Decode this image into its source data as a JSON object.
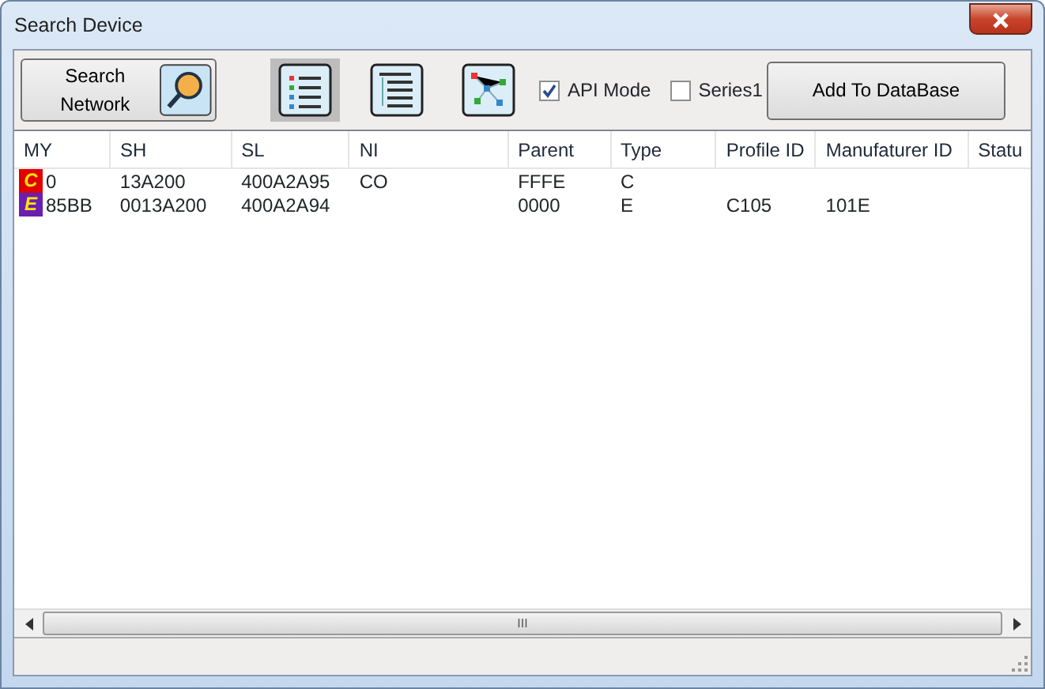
{
  "window": {
    "title": "Search Device"
  },
  "toolbar": {
    "search_button": "Search Network",
    "views": [
      {
        "kind": "list",
        "selected": true
      },
      {
        "kind": "tree",
        "selected": false
      },
      {
        "kind": "graph",
        "selected": false
      }
    ],
    "checkboxes": [
      {
        "label": "API Mode",
        "checked": true
      },
      {
        "label": "Series1",
        "checked": false
      }
    ],
    "add_button": "Add To DataBase"
  },
  "table": {
    "columns": [
      "MY",
      "SH",
      "SL",
      "NI",
      "Parent",
      "Type",
      "Profile ID",
      "Manufaturer ID",
      "Statu"
    ],
    "rows": [
      {
        "badge": "C",
        "color": "#e00000",
        "cells": [
          "0",
          "13A200",
          "400A2A95",
          "CO",
          "FFFE",
          "C",
          "",
          "",
          ""
        ]
      },
      {
        "badge": "E",
        "color": "#6a1fb0",
        "cells": [
          "85BB",
          "0013A200",
          "400A2A94",
          "",
          "0000",
          "E",
          "C105",
          "101E",
          ""
        ]
      }
    ]
  },
  "scrollbar": {
    "grip": "III"
  }
}
